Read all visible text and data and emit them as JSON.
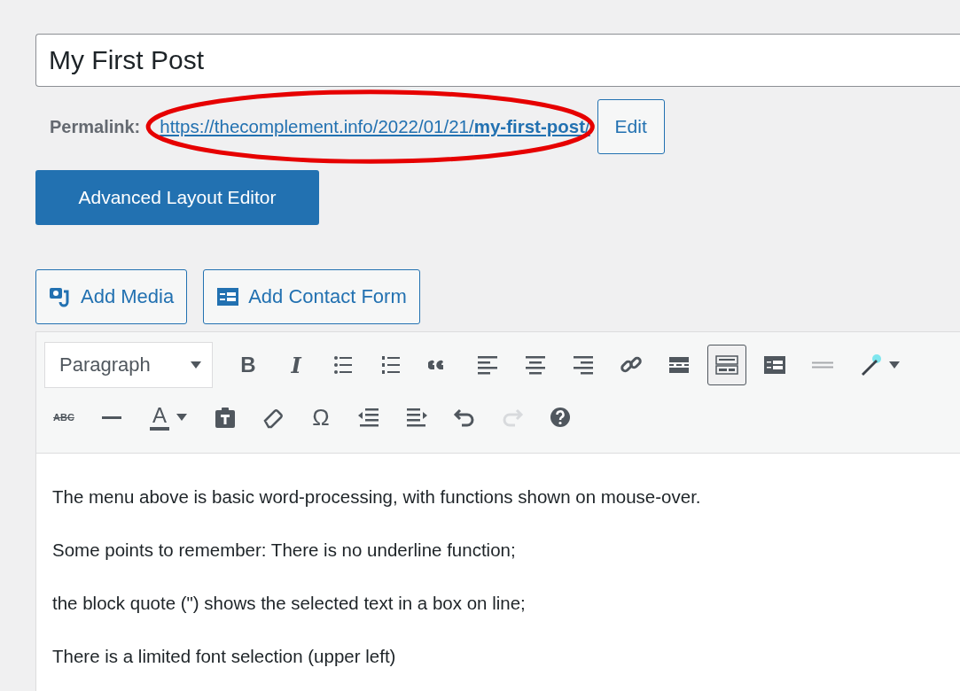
{
  "title_field": {
    "value": "My First Post"
  },
  "permalink": {
    "label": "Permalink:",
    "url": "https://thecomplement.info/2022/01/21/**my-first-post**/",
    "edit_button": "Edit"
  },
  "layout_button": "Advanced Layout Editor",
  "media_buttons": [
    {
      "kind": "media",
      "label": "Add Media"
    },
    {
      "kind": "form",
      "label": "Add Contact Form"
    }
  ],
  "editor": {
    "format_select": {
      "value": "Paragraph"
    },
    "toolbar_rows": [
      [
        {
          "kind": "bold",
          "label": "B",
          "active": false,
          "disabled": false
        },
        {
          "kind": "italic",
          "label": "I",
          "active": false,
          "disabled": false
        },
        {
          "kind": "bullet-list",
          "active": false,
          "disabled": false
        },
        {
          "kind": "numbered-list",
          "active": false,
          "disabled": false
        },
        {
          "kind": "quote",
          "active": false,
          "disabled": false
        },
        {
          "kind": "align-left",
          "active": false,
          "disabled": false
        },
        {
          "kind": "align-center",
          "active": false,
          "disabled": false
        },
        {
          "kind": "align-right",
          "active": false,
          "disabled": false
        },
        {
          "kind": "link",
          "active": false,
          "disabled": false
        },
        {
          "kind": "more",
          "active": false,
          "disabled": false
        },
        {
          "kind": "toolbar-toggle",
          "active": true,
          "disabled": false
        },
        {
          "kind": "form",
          "active": false,
          "disabled": false
        },
        {
          "kind": "divider",
          "active": false,
          "disabled": false
        },
        {
          "kind": "wand",
          "active": false,
          "disabled": false
        }
      ],
      [
        {
          "kind": "strikethrough",
          "label": "ABC",
          "active": false,
          "disabled": false
        },
        {
          "kind": "horizontal-line",
          "active": false,
          "disabled": false
        },
        {
          "kind": "text-color",
          "label": "A",
          "active": false,
          "disabled": false
        },
        {
          "kind": "paste-text",
          "active": false,
          "disabled": false
        },
        {
          "kind": "eraser",
          "active": false,
          "disabled": false
        },
        {
          "kind": "special-char",
          "label": "Ω",
          "active": false,
          "disabled": false
        },
        {
          "kind": "outdent",
          "active": false,
          "disabled": false
        },
        {
          "kind": "indent",
          "active": false,
          "disabled": false
        },
        {
          "kind": "undo",
          "active": false,
          "disabled": false
        },
        {
          "kind": "redo",
          "active": false,
          "disabled": true
        },
        {
          "kind": "help",
          "active": false,
          "disabled": false
        }
      ]
    ],
    "content": [
      "The menu above is basic word-processing, with functions shown on mouse-over.",
      "Some points to remember:  There is no underline function;",
      "the block quote (\") shows the selected text in a box on line;",
      "There is a limited font selection (upper left)"
    ]
  }
}
